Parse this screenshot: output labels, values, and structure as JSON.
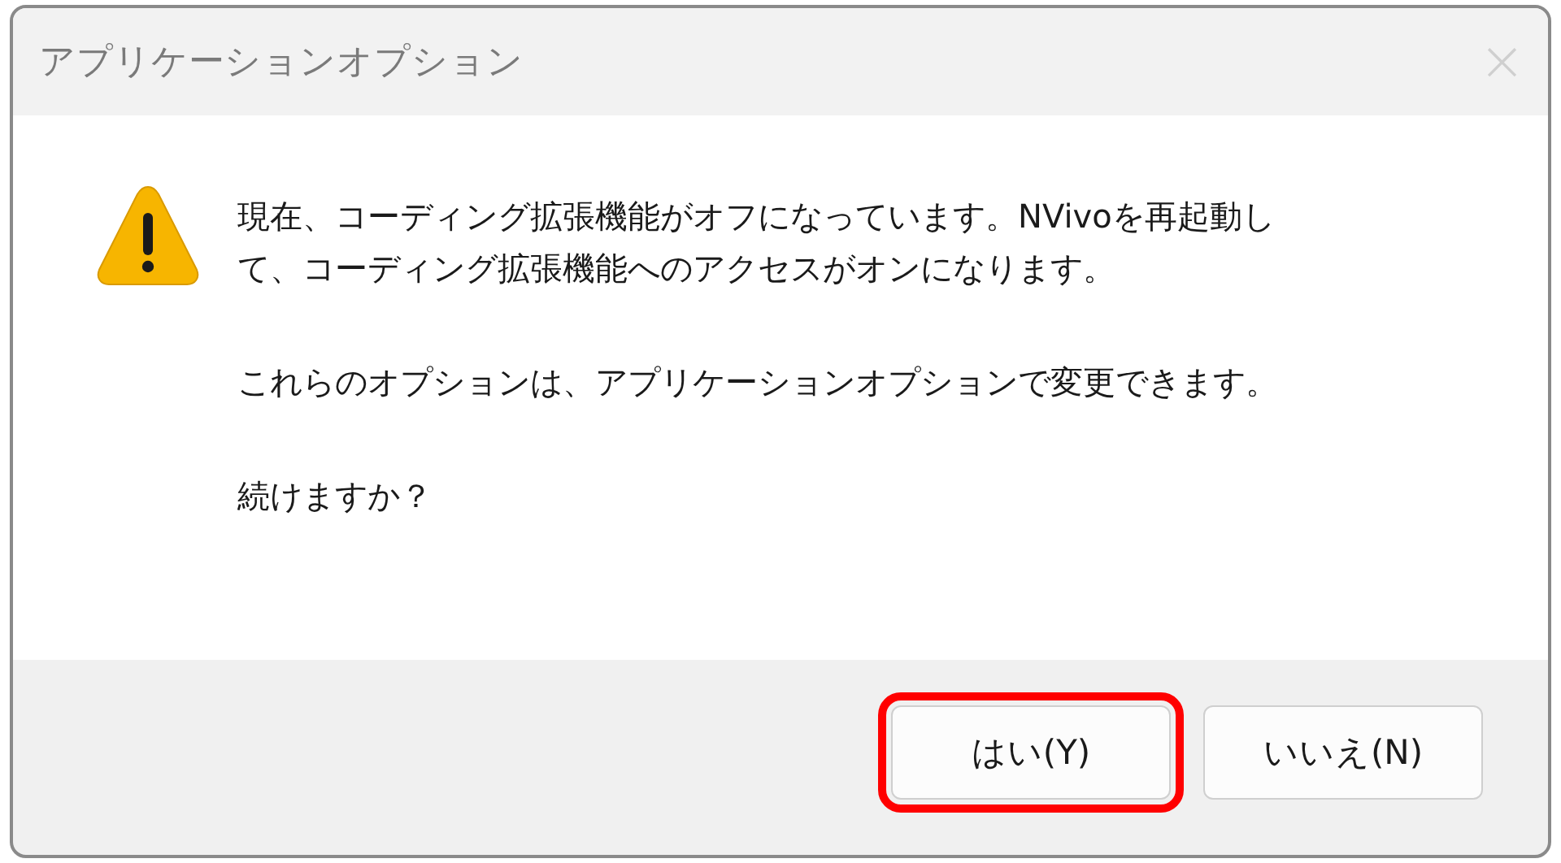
{
  "window": {
    "title": "アプリケーションオプション",
    "close": "×"
  },
  "message": {
    "paragraphs": [
      "現在、コーディング拡張機能がオフになっています。NVivoを再起動して、コーディング拡張機能へのアクセスがオンになります。",
      "これらのオプションは、アプリケーションオプションで変更できます。",
      "続けますか？"
    ]
  },
  "buttons": [
    {
      "label": "はい(Y)",
      "highlighted": true
    },
    {
      "label": "いいえ(N)",
      "highlighted": false
    }
  ]
}
